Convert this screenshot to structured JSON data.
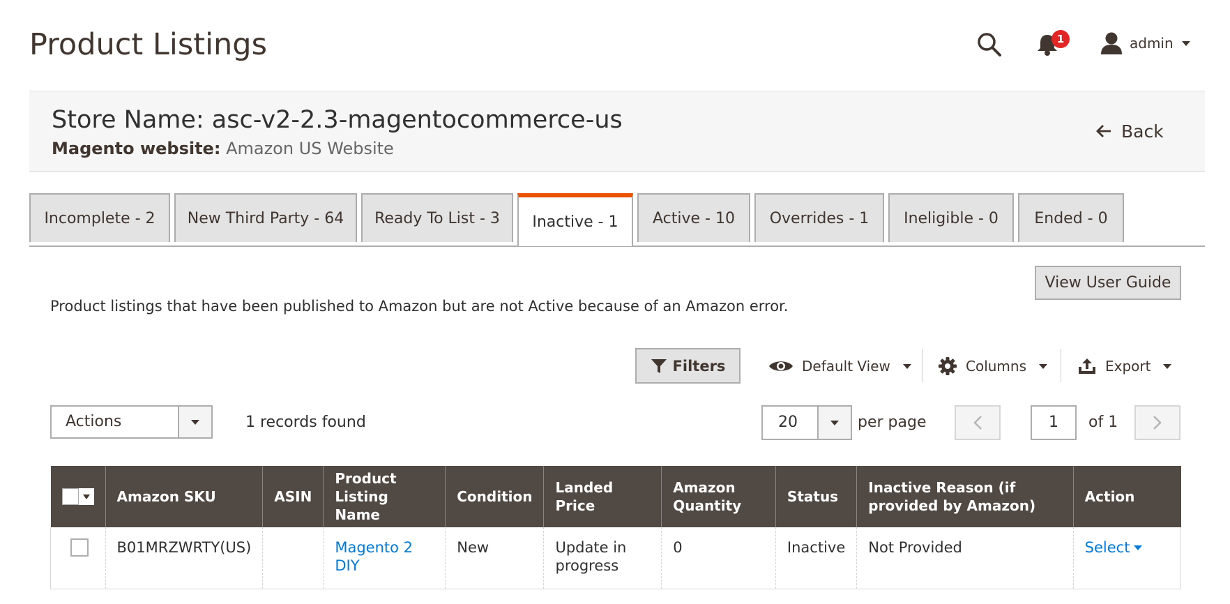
{
  "header": {
    "title": "Product Listings",
    "notifications_count": "1",
    "user_name": "admin"
  },
  "store": {
    "name": "Store Name: asc-v2-2.3-magentocommerce-us",
    "website_label": "Magento website:",
    "website_value": "Amazon US Website",
    "back_label": "Back"
  },
  "tabs": [
    {
      "label": "Incomplete - 2",
      "active": false
    },
    {
      "label": "New Third Party - 64",
      "active": false
    },
    {
      "label": "Ready To List - 3",
      "active": false
    },
    {
      "label": "Inactive - 1",
      "active": true
    },
    {
      "label": "Active - 10",
      "active": false
    },
    {
      "label": "Overrides - 1",
      "active": false
    },
    {
      "label": "Ineligible - 0",
      "active": false
    },
    {
      "label": "Ended - 0",
      "active": false
    }
  ],
  "view_guide_label": "View User Guide",
  "intro_text": "Product listings that have been published to Amazon but are not Active because of an Amazon error.",
  "toolbar": {
    "filters_label": "Filters",
    "view_label": "Default View",
    "columns_label": "Columns",
    "export_label": "Export"
  },
  "grid_controls": {
    "actions_label": "Actions",
    "records_found": "1 records found",
    "per_page_value": "20",
    "per_page_label": "per page",
    "page_value": "1",
    "page_of": "of 1"
  },
  "grid": {
    "columns": [
      "Amazon SKU",
      "ASIN",
      "Product Listing Name",
      "Condition",
      "Landed Price",
      "Amazon Quantity",
      "Status",
      "Inactive Reason (if provided by Amazon)",
      "Action"
    ],
    "rows": [
      {
        "sku": "B01MRZWRTY(US)",
        "asin": "",
        "name": "Magento 2 DIY",
        "condition": "New",
        "landed_price": "Update in progress",
        "quantity": "0",
        "status": "Inactive",
        "inactive_reason": "Not Provided",
        "action": "Select"
      }
    ]
  },
  "colors": {
    "accent": "#eb5202",
    "header_bg": "#514943",
    "link": "#007bdb",
    "badge": "#e22626"
  }
}
